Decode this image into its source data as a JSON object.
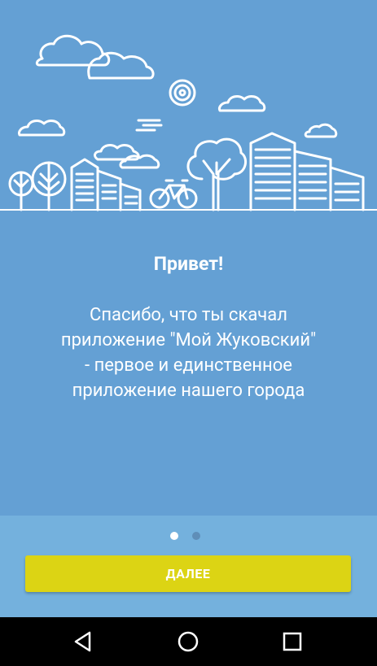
{
  "welcome": {
    "title": "Привет!",
    "message": "Спасибо, что ты скачал\nприложение \"Мой Жуковский\"\n- первое и единственное\nприложение нашего города"
  },
  "pager": {
    "pages": 2,
    "active_page": 1
  },
  "action": {
    "next_label": "ДАЛЕЕ"
  },
  "navigation": {
    "back_icon": "triangle-back-icon",
    "home_icon": "circle-home-icon",
    "recents_icon": "square-recents-icon"
  },
  "colors": {
    "background": "#64a0d4",
    "bottom_panel": "#74b1dd",
    "button": "#dcd414",
    "nav_bar": "#000000"
  }
}
